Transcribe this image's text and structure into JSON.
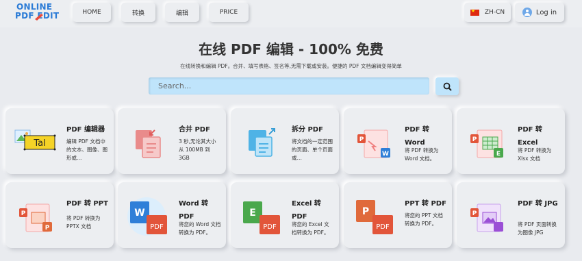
{
  "nav": {
    "logo_line1": "ONLINE",
    "logo_line2": "PDF EDIT",
    "items": [
      "HOME",
      "转换",
      "编辑",
      "PRICE"
    ],
    "lang": "ZH-CN",
    "login": "Log in"
  },
  "hero": {
    "title": "在线 PDF 编辑 - 100% 免费",
    "subtitle": "在线转换和编辑 PDF。合并、填写表格、签名等,无需下载或安装。便捷的 PDF 文档编辑变得简单"
  },
  "search": {
    "placeholder": "Search..."
  },
  "tools": [
    {
      "title": "PDF 编辑器",
      "desc": "编辑 PDF 文档中的文本、图像、图形或…",
      "icon": "pdf-editor-icon"
    },
    {
      "title": "合并 PDF",
      "desc": "3 秒,无论其大小从 100MB 到 3GB",
      "icon": "merge-pdf-icon"
    },
    {
      "title": "拆分 PDF",
      "desc": "将文档的一定范围的页面、单个页面或…",
      "icon": "split-pdf-icon"
    },
    {
      "title": "PDF 转 Word",
      "desc": "将 PDF 转换为 Word 文档。",
      "icon": "pdf-to-word-icon"
    },
    {
      "title": "PDF 转 Excel",
      "desc": "将 PDF 转换为 Xlsx 文档",
      "icon": "pdf-to-excel-icon"
    },
    {
      "title": "PDF 转 PPT",
      "desc": "将 PDF 转换为 PPTX 文档",
      "icon": "pdf-to-ppt-icon"
    },
    {
      "title": "Word 转 PDF",
      "desc": "将您的 Word 文档转换为 PDF。",
      "icon": "word-to-pdf-icon"
    },
    {
      "title": "Excel 转 PDF",
      "desc": "将您的 Excel 文档转换为 PDF。",
      "icon": "excel-to-pdf-icon"
    },
    {
      "title": "PPT 转 PDF",
      "desc": "将您的 PPT 文档转换为 PDF。",
      "icon": "ppt-to-pdf-icon"
    },
    {
      "title": "PDF 转 JPG",
      "desc": "将 PDF 页面转换为图像 JPG",
      "icon": "pdf-to-jpg-icon"
    }
  ],
  "icon_labels": {
    "editor_text": "Tal",
    "big_letter_word": "W",
    "big_letter_excel": "E",
    "big_letter_ppt": "P",
    "small_p": "P",
    "small_w": "W",
    "small_e": "E",
    "pdf_badge": "PDF"
  },
  "colors": {
    "background": "#e9ebef",
    "search_fill": "#bfe4fb",
    "brand_blue": "#2b7bd6",
    "pdf_red": "#e2553a",
    "word_blue": "#2f7fd8",
    "excel_green": "#4aa84c",
    "ppt_orange": "#e06a3b",
    "jpg_purple": "#9b4fd6"
  }
}
